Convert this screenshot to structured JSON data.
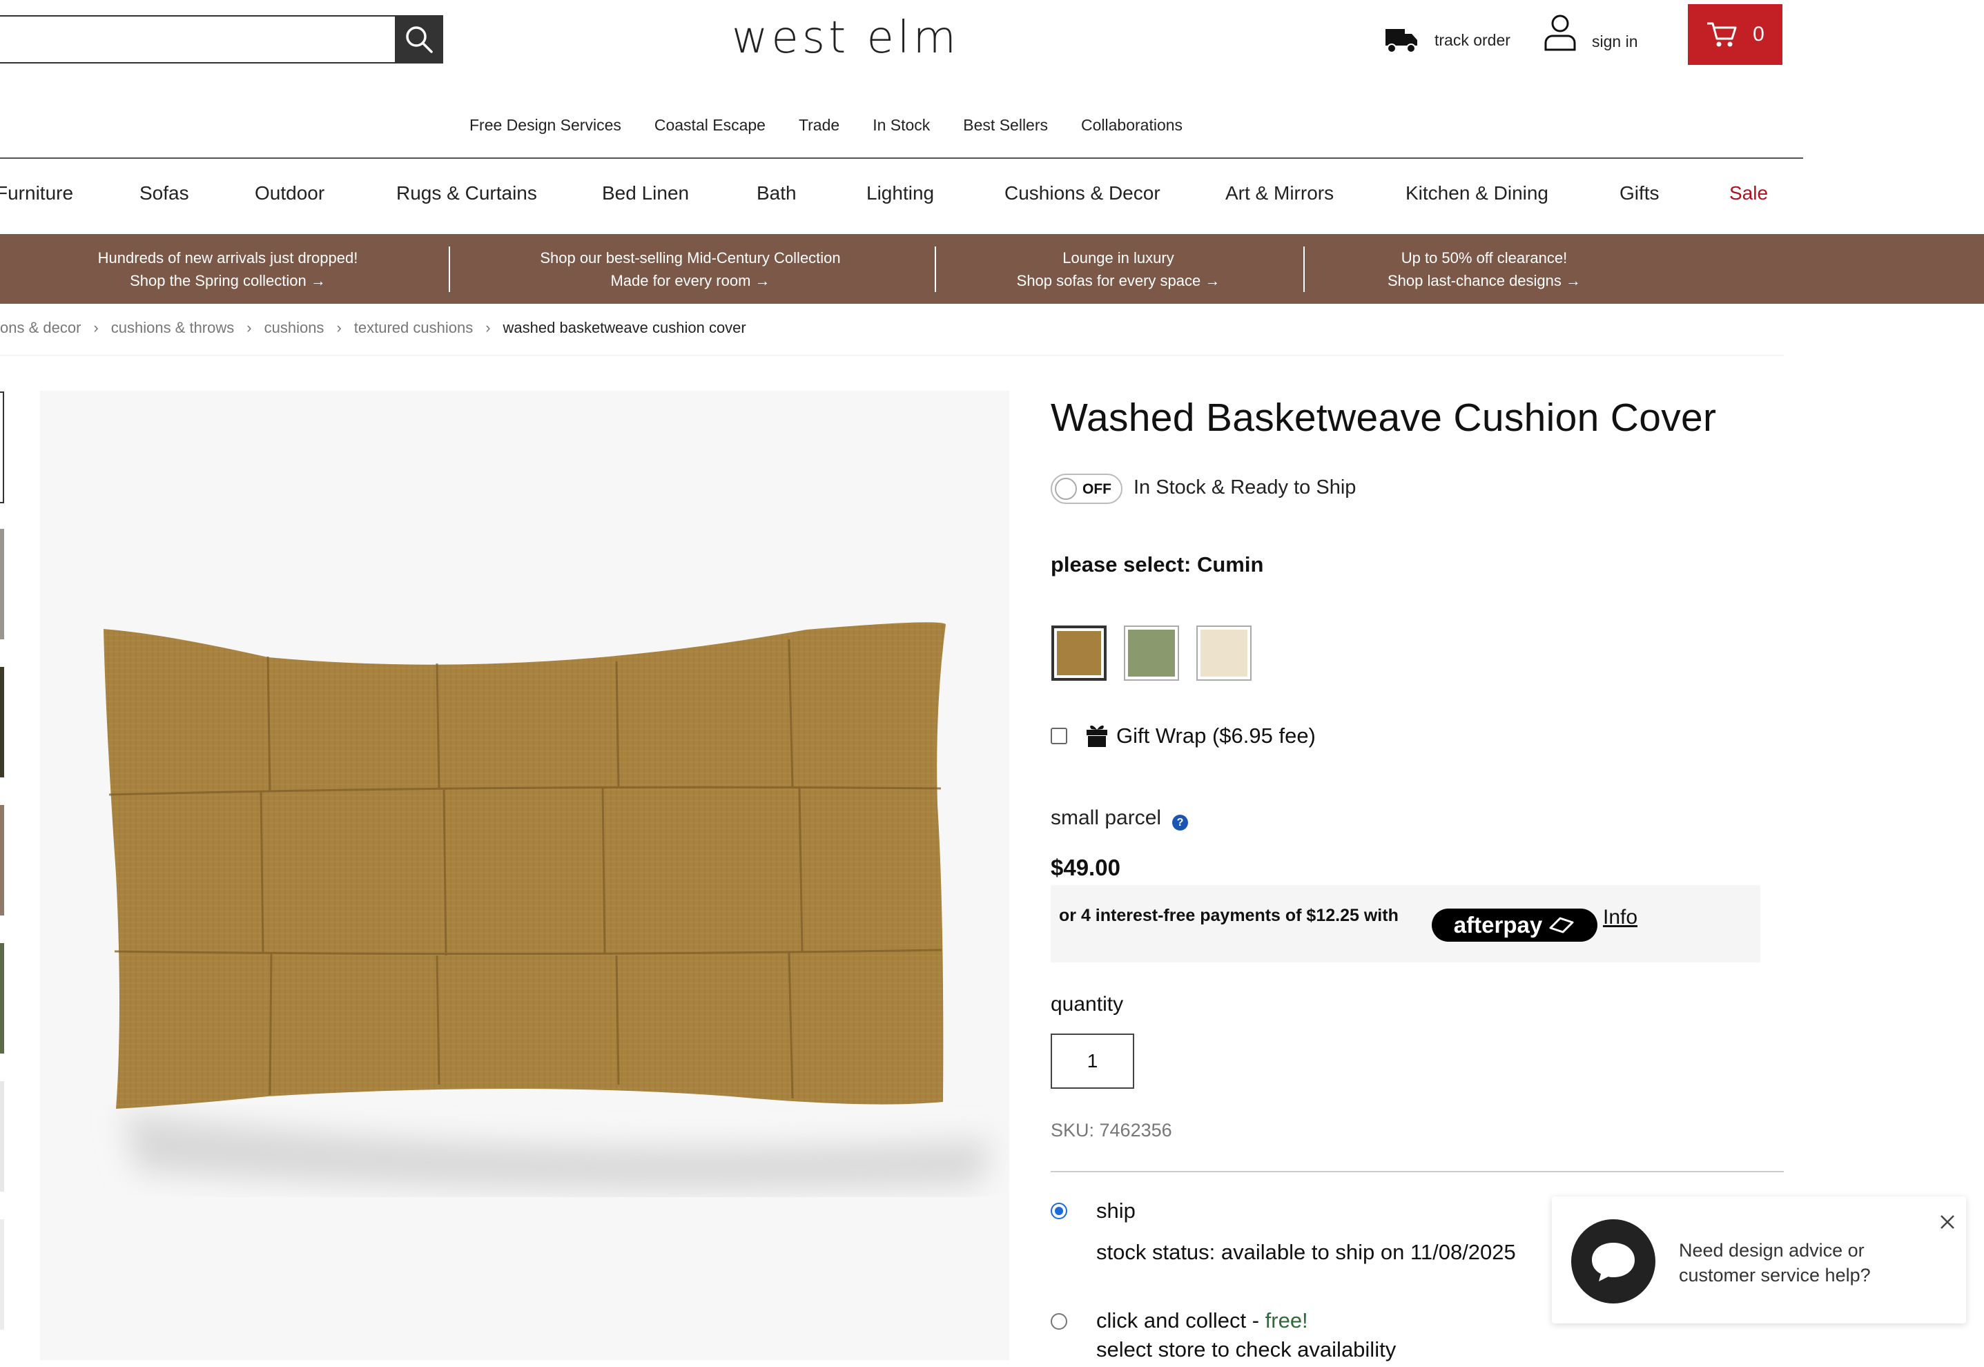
{
  "header": {
    "search": {
      "placeholder": "",
      "value": ""
    },
    "logo": "west elm",
    "track_order": "track order",
    "sign_in": "sign in",
    "cart_count": "0"
  },
  "top_nav": [
    "Free Design Services",
    "Coastal Escape",
    "Trade",
    "In Stock",
    "Best Sellers",
    "Collaborations"
  ],
  "category_nav": [
    "Furniture",
    "Sofas",
    "Outdoor",
    "Rugs & Curtains",
    "Bed Linen",
    "Bath",
    "Lighting",
    "Cushions & Decor",
    "Art & Mirrors",
    "Kitchen & Dining",
    "Gifts",
    "Sale"
  ],
  "promos": [
    {
      "line1": "Hundreds of new arrivals just dropped!",
      "line2": "Shop the Spring collection →"
    },
    {
      "line1": "Shop our best-selling Mid-Century Collection",
      "line2": "Made for every room →"
    },
    {
      "line1": "Lounge in luxury",
      "line2": "Shop sofas for every space →"
    },
    {
      "line1": "Up to 50% off clearance!",
      "line2": "Shop last-chance designs →"
    }
  ],
  "breadcrumb": [
    "ons & decor",
    "cushions & throws",
    "cushions",
    "textured cushions",
    "washed basketweave cushion cover"
  ],
  "product": {
    "title": "Washed Basketweave Cushion Cover",
    "toggle_state": "OFF",
    "in_stock_label": "In Stock & Ready to Ship",
    "select_label": "please select: Cumin",
    "swatches": [
      {
        "name": "Cumin",
        "color": "#a5803f",
        "selected": true
      },
      {
        "name": "Green",
        "color": "#8b9a6e",
        "selected": false
      },
      {
        "name": "Cream",
        "color": "#ede3cd",
        "selected": false
      }
    ],
    "gift_wrap": "Gift Wrap ($6.95 fee)",
    "parcel": "small parcel",
    "price": "$49.00",
    "afterpay_text": "or 4 interest-free payments of $12.25 with",
    "afterpay_brand": "afterpay",
    "afterpay_info": "Info",
    "quantity_label": "quantity",
    "quantity_value": "1",
    "sku": "SKU: 7462356"
  },
  "delivery": {
    "ship_label": "ship",
    "ship_status": "stock status: available to ship on 11/08/2025",
    "collect_label": "click and collect - ",
    "collect_free": "free!",
    "collect_status": "select store to check availability"
  },
  "chat": {
    "message": "Need design advice or customer service help?"
  },
  "colors": {
    "brand_red": "#c32026",
    "promo_bg": "#7b5848",
    "sale_red": "#b3101e",
    "radio_blue": "#1a6ad8"
  }
}
